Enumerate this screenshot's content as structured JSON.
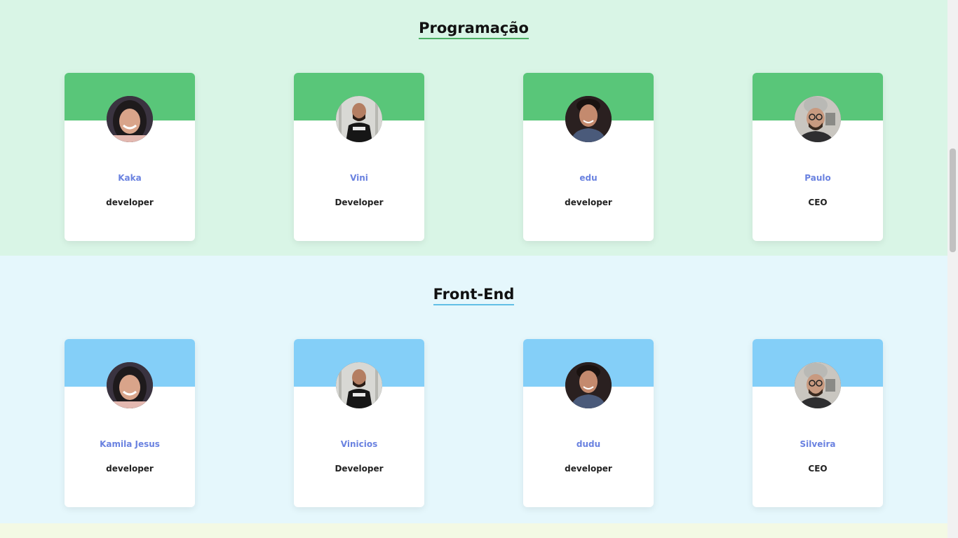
{
  "sections": [
    {
      "title": "Programação",
      "members": [
        {
          "name": "Kaka",
          "role": "developer",
          "avatar": "avatar-photo-woman-dark-hair"
        },
        {
          "name": "Vini",
          "role": "Developer",
          "avatar": "avatar-photo-man-coffee-shirt"
        },
        {
          "name": "edu",
          "role": "developer",
          "avatar": "avatar-photo-young-man"
        },
        {
          "name": "Paulo",
          "role": "CEO",
          "avatar": "avatar-photo-man-beanie-glasses"
        }
      ]
    },
    {
      "title": "Front-End",
      "members": [
        {
          "name": "Kamila Jesus",
          "role": "developer",
          "avatar": "avatar-photo-woman-dark-hair"
        },
        {
          "name": "Vinicios",
          "role": "Developer",
          "avatar": "avatar-photo-man-coffee-shirt"
        },
        {
          "name": "dudu",
          "role": "developer",
          "avatar": "avatar-photo-young-man"
        },
        {
          "name": "Silveira",
          "role": "CEO",
          "avatar": "avatar-photo-man-beanie-glasses"
        }
      ]
    }
  ],
  "colors": {
    "programacao_bg": "#d9f5e6",
    "programacao_accent": "#59c679",
    "frontend_bg": "#e5f7fc",
    "frontend_accent": "#84cff8",
    "name_text": "#6a82e0"
  }
}
